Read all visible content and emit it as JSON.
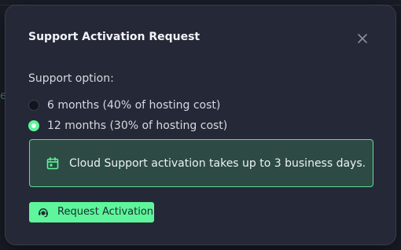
{
  "modal": {
    "title": "Support Activation Request",
    "close_icon": "close-icon"
  },
  "support": {
    "label": "Support option:",
    "options": [
      {
        "label": "6 months (40% of hosting cost)",
        "selected": false
      },
      {
        "label": "12 months (30% of hosting cost)",
        "selected": true
      }
    ]
  },
  "alert": {
    "icon": "calendar-icon",
    "text": "Cloud Support activation takes up to 3 business days."
  },
  "actions": {
    "request_icon": "support-agent-icon",
    "request_label": "Request Activation"
  },
  "colors": {
    "background": "#191c26",
    "modal_bg": "#252836",
    "accent": "#5ff59c",
    "alert_bg": "#2d4a44",
    "alert_border": "#5fdc98"
  }
}
